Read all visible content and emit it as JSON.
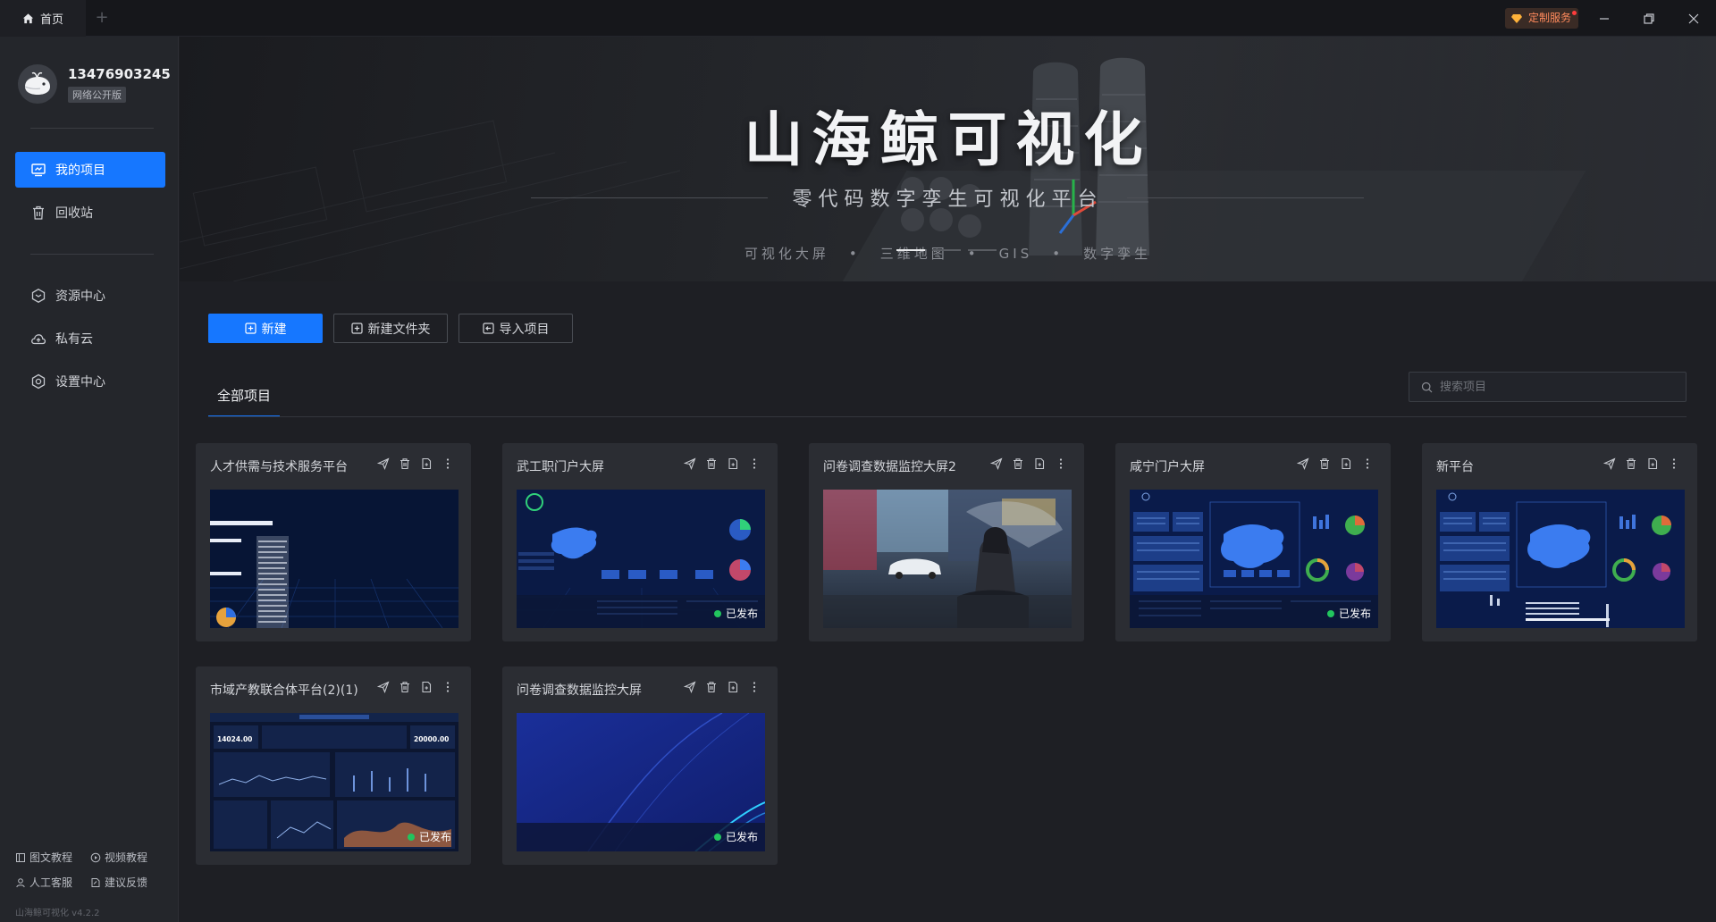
{
  "titlebar": {
    "home_tab": "首页",
    "add_tab": "+",
    "custom_service": "定制服务"
  },
  "profile": {
    "phone": "13476903245",
    "edition": "网络公开版"
  },
  "sidebar": {
    "items": [
      {
        "label": "我的项目",
        "icon": "monitor-icon",
        "active": true
      },
      {
        "label": "回收站",
        "icon": "trash-icon",
        "active": false
      },
      {
        "label": "资源中心",
        "icon": "cube-icon",
        "active": false
      },
      {
        "label": "私有云",
        "icon": "cloud-icon",
        "active": false
      },
      {
        "label": "设置中心",
        "icon": "gear-icon",
        "active": false
      }
    ],
    "footer": {
      "doc_tutorial": "图文教程",
      "video_tutorial": "视频教程",
      "support": "人工客服",
      "feedback": "建议反馈",
      "version": "山海鲸可视化 v4.2.2"
    }
  },
  "banner": {
    "title": "山海鲸可视化",
    "subtitle": "零代码数字孪生可视化平台",
    "tags": [
      "可视化大屏",
      "三维地图",
      "GIS",
      "数字孪生"
    ]
  },
  "toolbar": {
    "new_label": "新建",
    "new_folder_label": "新建文件夹",
    "import_label": "导入项目"
  },
  "tabs": {
    "all_projects": "全部项目"
  },
  "search": {
    "placeholder": "搜索项目"
  },
  "projects": [
    {
      "title": "人才供需与技术服务平台",
      "published": false,
      "thumb": "dark-grid"
    },
    {
      "title": "武工职门户大屏",
      "published": true,
      "status": "已发布",
      "thumb": "china-map"
    },
    {
      "title": "问卷调查数据监控大屏2",
      "published": false,
      "thumb": "anime-photo"
    },
    {
      "title": "咸宁门户大屏",
      "published": true,
      "status": "已发布",
      "thumb": "china-map-panels"
    },
    {
      "title": "新平台",
      "published": false,
      "thumb": "china-map-panels"
    },
    {
      "title": "市域产教联合体平台(2)(1)",
      "published": true,
      "status": "已发布",
      "thumb": "dashboard-charts",
      "thumb_text": [
        "14024.00",
        "20000.00"
      ]
    },
    {
      "title": "问卷调查数据监控大屏",
      "published": true,
      "status": "已发布",
      "thumb": "blue-waves"
    }
  ],
  "colors": {
    "accent": "#1677ff",
    "sidebar_bg": "#24262b",
    "main_bg": "#1e1f24",
    "card_bg": "#2b2d33",
    "published_dot": "#22c55e"
  }
}
